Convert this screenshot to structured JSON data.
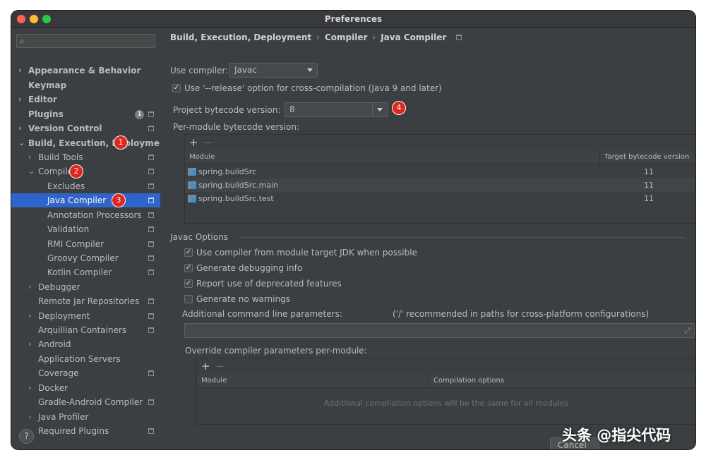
{
  "window": {
    "title": "Preferences"
  },
  "search": {
    "placeholder": ""
  },
  "sidebar": {
    "items": [
      {
        "label": "Appearance & Behavior",
        "chevron": "›",
        "config": false
      },
      {
        "label": "Keymap",
        "chevron": "",
        "config": false
      },
      {
        "label": "Editor",
        "chevron": "›",
        "config": false
      },
      {
        "label": "Plugins",
        "chevron": "",
        "config": true,
        "count": "1"
      },
      {
        "label": "Version Control",
        "chevron": "›",
        "config": true
      },
      {
        "label": "Build, Execution, Deployment",
        "chevron": "⌄",
        "config": false
      },
      {
        "label": "Build Tools",
        "chevron": "›",
        "config": true
      },
      {
        "label": "Compiler",
        "chevron": "⌄",
        "config": true
      },
      {
        "label": "Excludes",
        "chevron": "",
        "config": true
      },
      {
        "label": "Java Compiler",
        "chevron": "",
        "config": true
      },
      {
        "label": "Annotation Processors",
        "chevron": "",
        "config": true
      },
      {
        "label": "Validation",
        "chevron": "",
        "config": true
      },
      {
        "label": "RMI Compiler",
        "chevron": "",
        "config": true
      },
      {
        "label": "Groovy Compiler",
        "chevron": "",
        "config": true
      },
      {
        "label": "Kotlin Compiler",
        "chevron": "",
        "config": true
      },
      {
        "label": "Debugger",
        "chevron": "›",
        "config": false
      },
      {
        "label": "Remote Jar Repositories",
        "chevron": "",
        "config": true
      },
      {
        "label": "Deployment",
        "chevron": "›",
        "config": true
      },
      {
        "label": "Arquillian Containers",
        "chevron": "",
        "config": true
      },
      {
        "label": "Android",
        "chevron": "›",
        "config": false
      },
      {
        "label": "Application Servers",
        "chevron": "",
        "config": false
      },
      {
        "label": "Coverage",
        "chevron": "",
        "config": true
      },
      {
        "label": "Docker",
        "chevron": "›",
        "config": false
      },
      {
        "label": "Gradle-Android Compiler",
        "chevron": "",
        "config": true
      },
      {
        "label": "Java Profiler",
        "chevron": "›",
        "config": false
      },
      {
        "label": "Required Plugins",
        "chevron": "",
        "config": true
      }
    ],
    "badges": [
      "1",
      "2",
      "3"
    ]
  },
  "breadcrumb": {
    "parts": [
      "Build, Execution, Deployment",
      "Compiler",
      "Java Compiler"
    ],
    "separator": "›"
  },
  "compiler": {
    "use_compiler_label": "Use compiler:",
    "use_compiler_value": "Javac",
    "release_option_label": "Use '--release' option for cross-compilation (Java 9 and later)",
    "release_option_checked": true,
    "bytecode_label": "Project bytecode version:",
    "bytecode_value": "8",
    "bytecode_badge": "4",
    "per_module_label": "Per-module bytecode version:"
  },
  "module_table": {
    "add": "+",
    "remove": "−",
    "headers": [
      "Module",
      "Target bytecode version"
    ],
    "rows": [
      {
        "module": "spring.buildSrc",
        "version": "11"
      },
      {
        "module": "spring.buildSrc.main",
        "version": "11"
      },
      {
        "module": "spring.buildSrc.test",
        "version": "11"
      }
    ]
  },
  "javac": {
    "section_title": "Javac Options",
    "options": [
      {
        "label": "Use compiler from module target JDK when possible",
        "checked": true
      },
      {
        "label": "Generate debugging info",
        "checked": true
      },
      {
        "label": "Report use of deprecated features",
        "checked": true
      },
      {
        "label": "Generate no warnings",
        "checked": false
      }
    ],
    "additional_params_label": "Additional command line parameters:",
    "additional_params_hint": "('/' recommended in paths for cross-platform configurations)",
    "override_label": "Override compiler parameters per-module:",
    "override_headers": [
      "Module",
      "Compilation options"
    ],
    "override_empty": "Additional compilation options will be the same for all modules"
  },
  "footer": {
    "help": "?",
    "cancel": "Cancel"
  },
  "watermark": "头条 @指尖代码"
}
